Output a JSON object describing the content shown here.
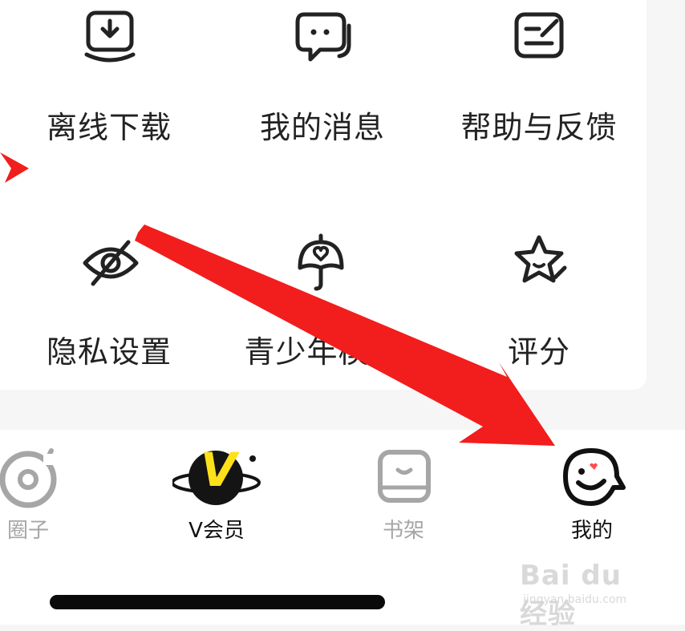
{
  "menu": {
    "offline_download": "离线下载",
    "my_messages": "我的消息",
    "help_feedback": "帮助与反馈",
    "privacy_settings": "隐私设置",
    "teen_mode": "青少年模式",
    "rating": "评分"
  },
  "tabs": {
    "circle": "圈子",
    "vip": "V会员",
    "vip_badge": "V",
    "bookshelf": "书架",
    "mine": "我的"
  },
  "watermark": {
    "main": "Bai du 经验",
    "sub": "jingyan.baidu.com"
  },
  "colors": {
    "text_primary": "#222222",
    "tab_inactive": "#a6a6a6",
    "tab_active": "#111111",
    "vip_yellow": "#ffe11a",
    "arrow_red": "#f21d1d",
    "heart_red": "#ff4d4f"
  }
}
